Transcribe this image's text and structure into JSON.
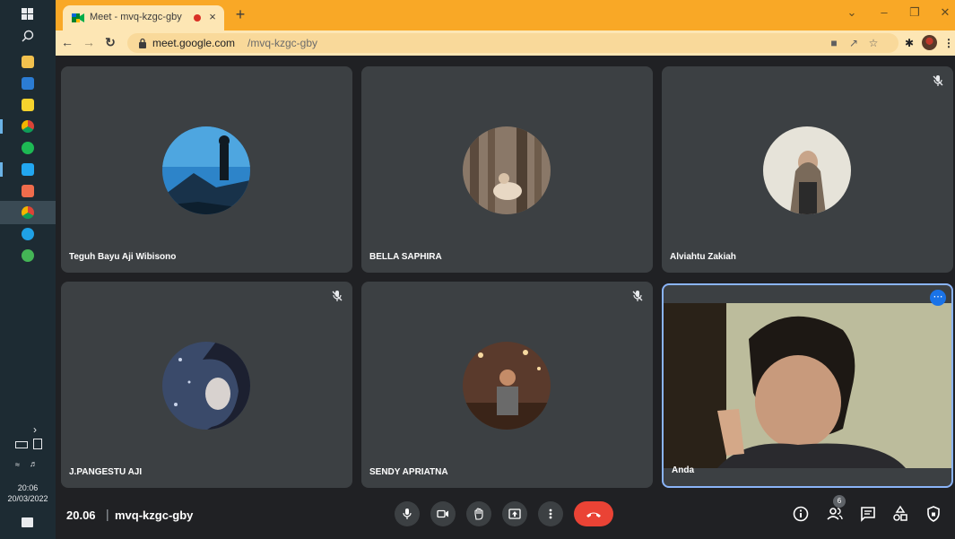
{
  "browser": {
    "tab_title": "Meet - mvq-kzgc-gby",
    "tab_close": "×",
    "new_tab": "+",
    "url_host": "meet.google.com",
    "url_path": "/mvq-kzgc-gby",
    "accent": "#f9a826"
  },
  "taskbar": {
    "clock_time": "20:06",
    "clock_date": "20/03/2022"
  },
  "participants": [
    {
      "name": "Teguh Bayu Aji Wibisono",
      "muted": false
    },
    {
      "name": "BELLA SAPHIRA",
      "muted": false
    },
    {
      "name": "Alviahtu Zakiah",
      "muted": true
    },
    {
      "name": "J.PANGESTU AJI",
      "muted": true
    },
    {
      "name": "SENDY APRIATNA",
      "muted": true
    },
    {
      "name": "Anda",
      "muted": false,
      "self": true
    }
  ],
  "meeting": {
    "time": "20.06",
    "separator": "|",
    "code": "mvq-kzgc-gby",
    "people_count": "6",
    "end_color": "#ea4335",
    "self_border": "#8ab4f8"
  }
}
